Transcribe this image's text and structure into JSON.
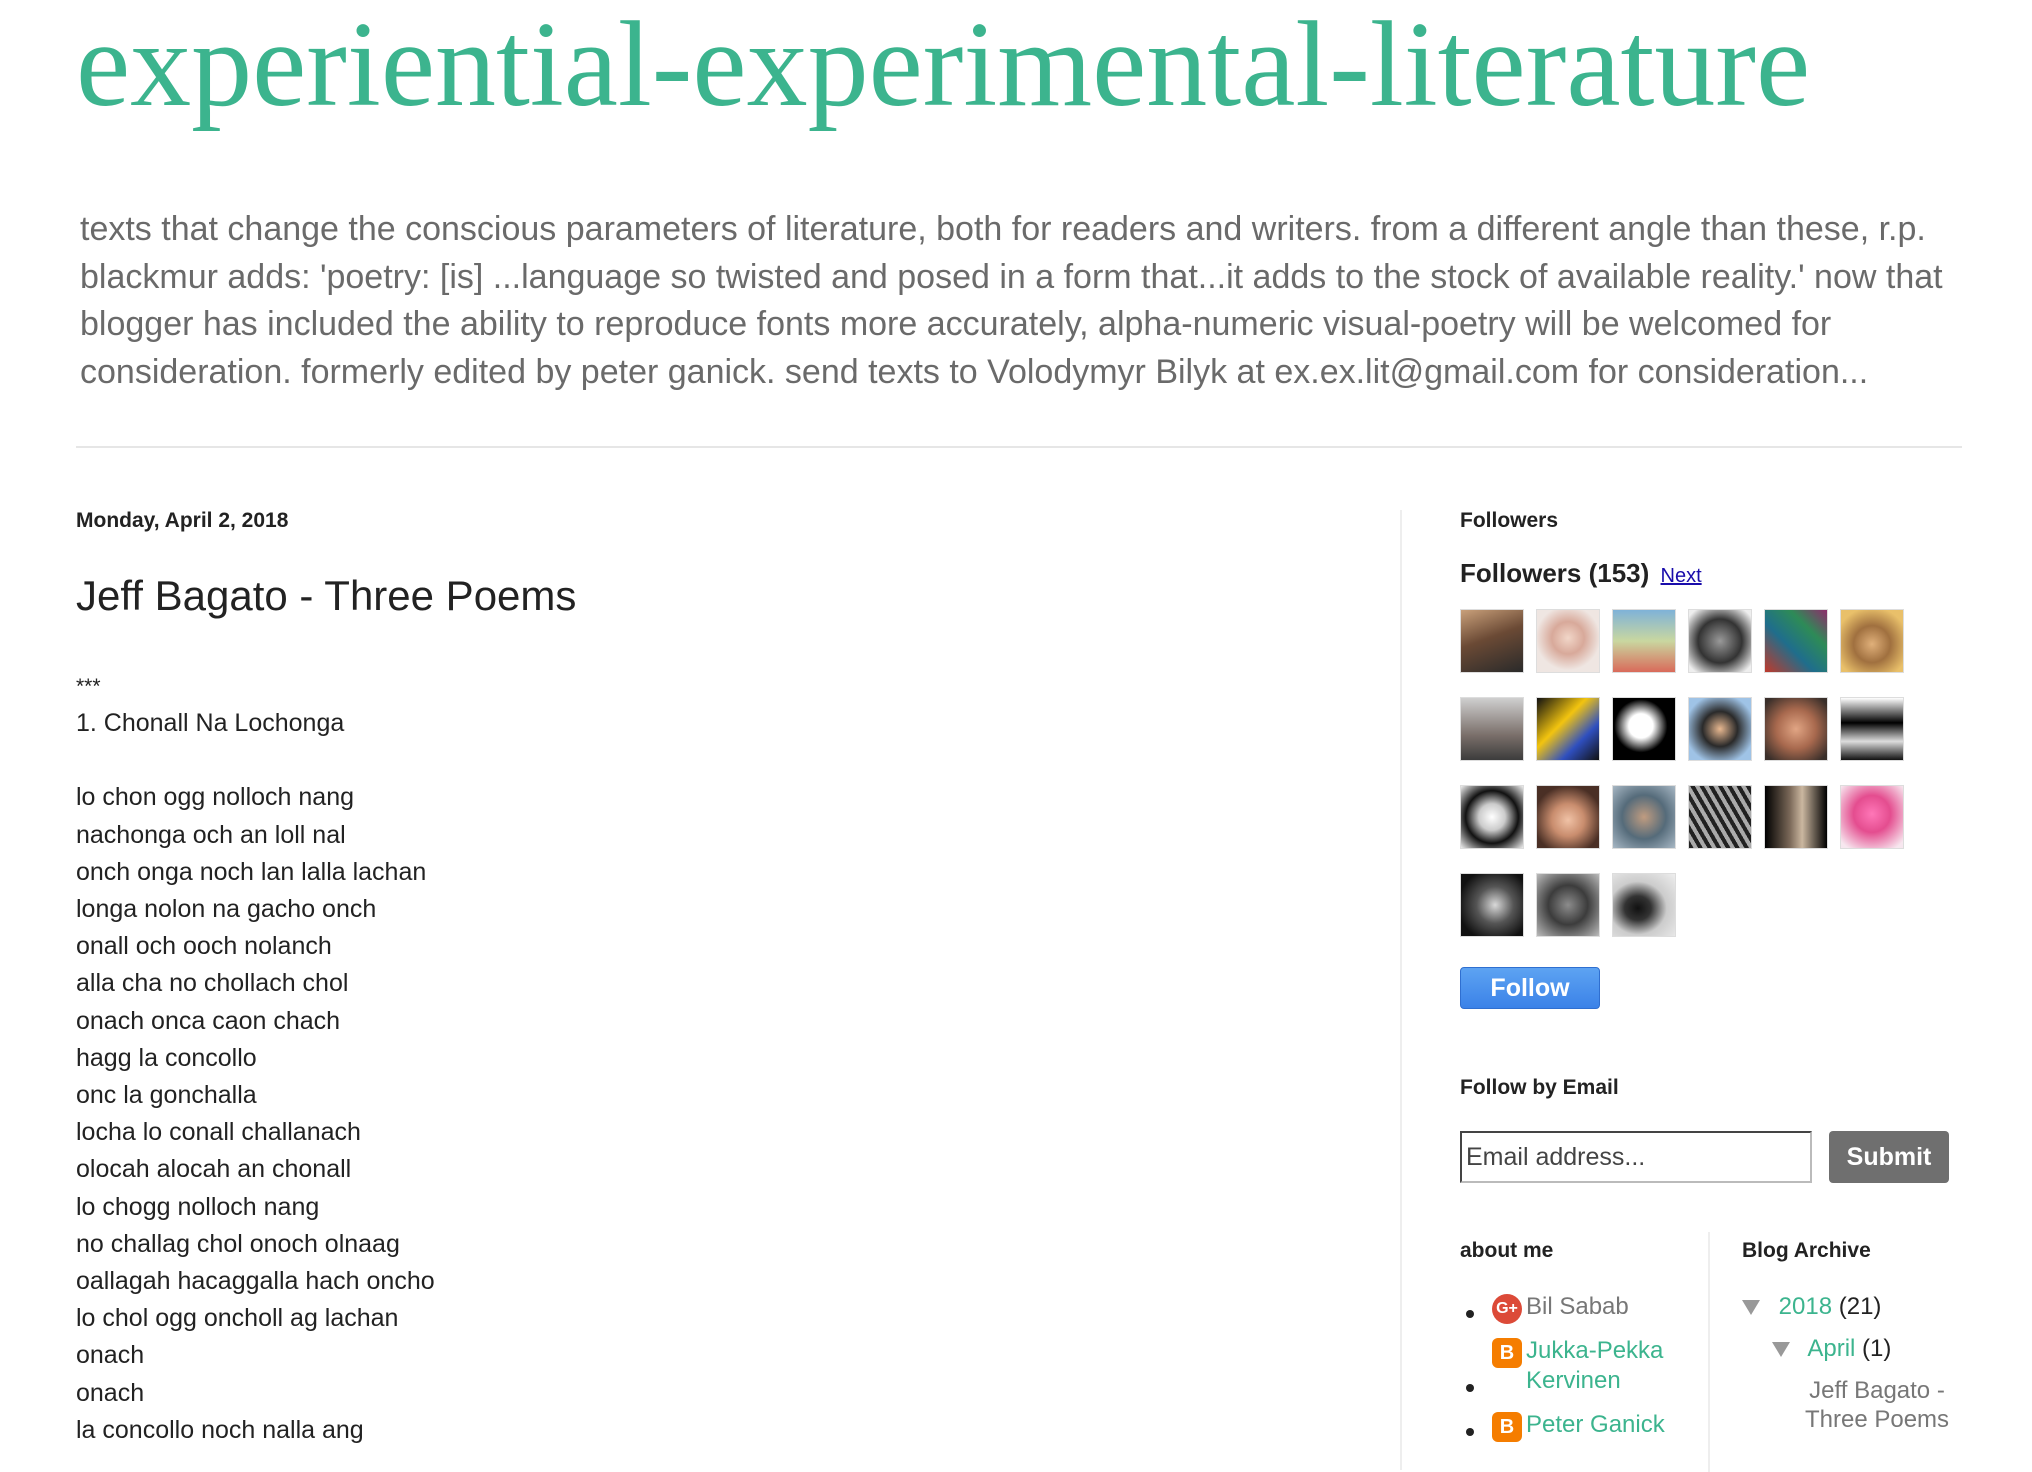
{
  "header": {
    "title": "experiential-experimental-literature",
    "description": "texts that change the conscious parameters of literature, both for readers and writers. from a different angle than these, r.p. blackmur adds: 'poetry: [is] ...language so twisted and posed in a form that...it adds to the stock of available reality.' now that blogger has included the ability to reproduce fonts more accurately, alpha-numeric visual-poetry will be welcomed for consideration. formerly edited by peter ganick. send texts to Volodymyr Bilyk at ex.ex.lit@gmail.com for consideration..."
  },
  "post": {
    "date": "Monday, April 2, 2018",
    "title": "Jeff Bagato - Three Poems",
    "stars": "***",
    "section_title": "1. Chonall Na Lochonga",
    "lines": [
      "lo chon ogg nolloch nang",
      "nachonga och an loll nal",
      "onch onga noch lan lalla lachan",
      "longa nolon na gacho onch",
      "onall och ooch nolanch",
      "alla cha no chollach chol",
      "onach onca caon chach",
      "hagg la concollo",
      "onc la gonchalla",
      "locha lo conall challanach",
      "olocah alocah an chonall",
      "lo chogg nolloch nang",
      "no challag chol onoch olnaag",
      "oallagah hacaggalla hach oncho",
      "lo chol ogg oncholl ag lachan",
      "onach",
      "onach",
      "la concollo noch nalla ang"
    ]
  },
  "sidebar": {
    "followers_title": "Followers",
    "followers_label": "Followers (153)",
    "next_label": "Next",
    "follow_label": "Follow",
    "follow_email_title": "Follow by Email",
    "email_placeholder": "Email address...",
    "submit_label": "Submit",
    "about_title": "about me",
    "about_profiles": [
      {
        "name": "Bil Sabab",
        "icon": "google-plus-icon"
      },
      {
        "name": "Jukka-Pekka Kervinen",
        "icon": "blogger-icon"
      },
      {
        "name": "Peter Ganick",
        "icon": "blogger-icon"
      }
    ],
    "archive_title": "Blog Archive",
    "archive_year": "2018",
    "archive_year_count": "(21)",
    "archive_month": "April",
    "archive_month_count": "(1)",
    "archive_post": "Jeff Bagato - Three Poems"
  },
  "colors": {
    "accent": "#3cb48e",
    "description_text": "#6a6a6a",
    "follow_button": "#3b82e8",
    "submit_button": "#6f6f6f",
    "link": "#1a0dab"
  }
}
